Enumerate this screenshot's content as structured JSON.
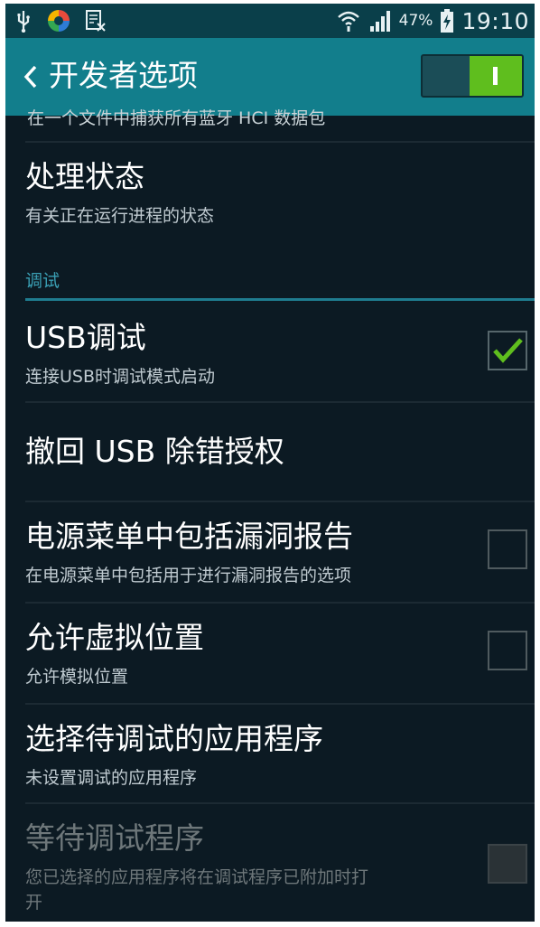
{
  "status_bar": {
    "battery_percent": "47%",
    "time": "19:10",
    "icons": [
      "usb-icon",
      "app-icon",
      "excel-icon",
      "wifi-icon",
      "signal-icon",
      "battery-charging-icon"
    ]
  },
  "action_bar": {
    "title": "开发者选项",
    "master_switch_on": true
  },
  "list": {
    "partial_item_text": "在一个文件中捕获所有蓝牙 HCI 数据包",
    "items": [
      {
        "title": "处理状态",
        "subtitle": "有关正在运行进程的状态"
      },
      {
        "title": "USB调试",
        "subtitle": "连接USB时调试模式启动",
        "checked": true
      },
      {
        "title": "撤回 USB 除错授权"
      },
      {
        "title": "电源菜单中包括漏洞报告",
        "subtitle": "在电源菜单中包括用于进行漏洞报告的选项",
        "checked": false
      },
      {
        "title": "允许虚拟位置",
        "subtitle": "允许模拟位置",
        "checked": false
      },
      {
        "title": "选择待调试的应用程序",
        "subtitle": "未设置调试的应用程序"
      },
      {
        "title": "等待调试程序",
        "subtitle_line1": "您已选择的应用程序将在调试程序已附加时打",
        "subtitle_line2": "开",
        "checked": false,
        "enabled": false
      }
    ],
    "section_header": "调试"
  },
  "colors": {
    "accent": "#127e8c",
    "check_green": "#5fbe1e",
    "background": "#0c1a23"
  }
}
